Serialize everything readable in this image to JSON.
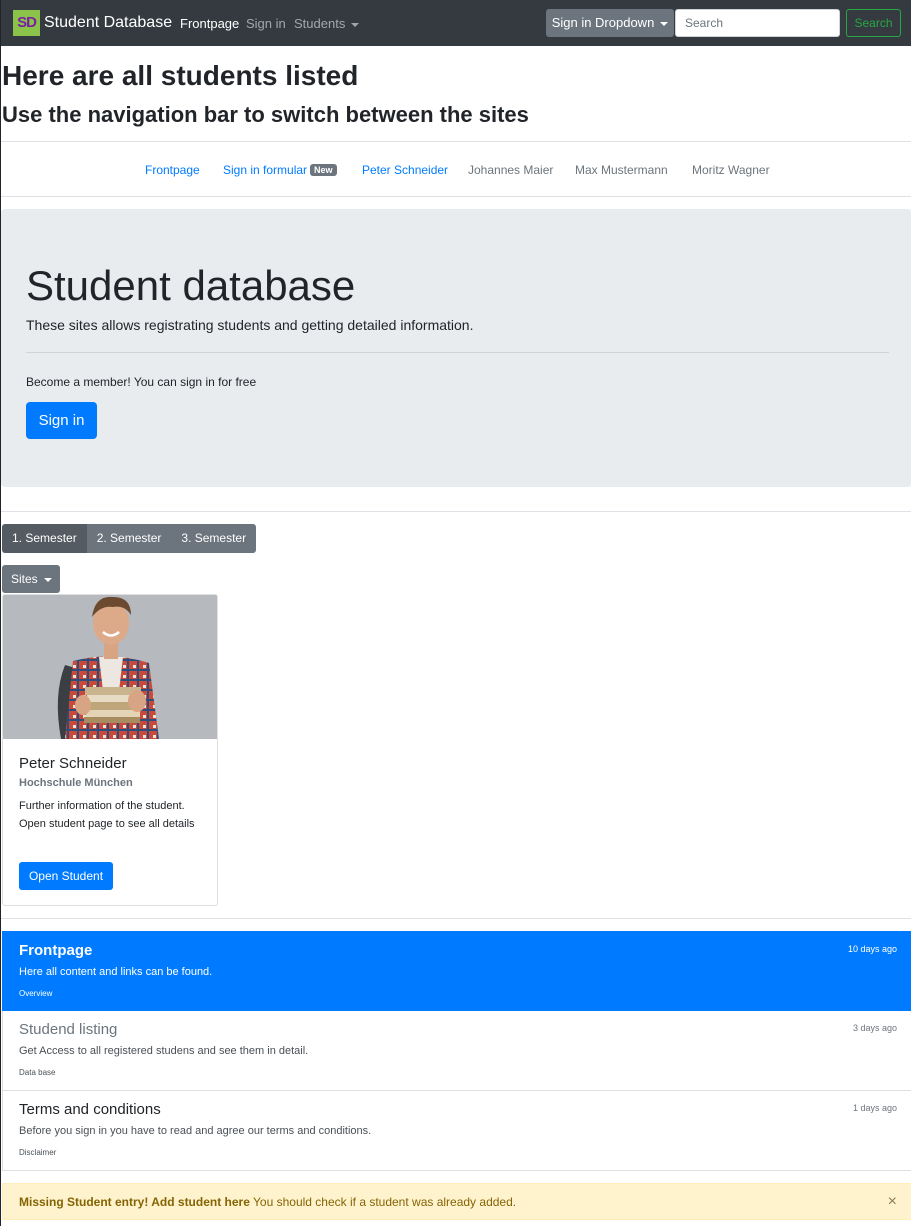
{
  "navbar": {
    "logo": "SD",
    "brand": "Student Database",
    "links": [
      "Frontpage",
      "Sign in",
      "Students"
    ],
    "signin_dropdown": "Sign in Dropdown",
    "search_placeholder": "Search",
    "search_button": "Search"
  },
  "header": {
    "title": "Here are all students listed",
    "subtitle": "Use the navigation bar to switch between the sites"
  },
  "subnav": {
    "items": [
      "Frontpage",
      "Sign in formular",
      "Peter Schneider",
      "Johannes Maier",
      "Max Mustermann",
      "Moritz Wagner"
    ],
    "badge": "New"
  },
  "jumbotron": {
    "title": "Student database",
    "lead": "These sites allows registrating students and getting detailed information.",
    "text": "Become a member! You can sign in for free",
    "button": "Sign in"
  },
  "semesters": [
    "1. Semester",
    "2. Semester",
    "3. Semester"
  ],
  "sites_dropdown": "Sites",
  "card": {
    "title": "Peter Schneider",
    "subtitle": "Hochschule München",
    "text": "Further information of the student. Open student page to see all details",
    "button": "Open Student"
  },
  "list": [
    {
      "title": "Frontpage",
      "time": "10 days ago",
      "desc": "Here all content and links can be found.",
      "small": "Overview"
    },
    {
      "title": "Studend listing",
      "time": "3 days ago",
      "desc": "Get Access to all registered studens and see them in detail.",
      "small": "Data base"
    },
    {
      "title": "Terms and conditions",
      "time": "1 days ago",
      "desc": "Before you sign in you have to read and agree our terms and conditions.",
      "small": "Disclaimer"
    }
  ],
  "alert": {
    "strong": "Missing Student entry! Add student here",
    "text": " You should check if a student was already added.",
    "close": "×"
  },
  "colors": {
    "primary": "#007bff",
    "secondary": "#6c757d",
    "success": "#28a745",
    "dark": "#343a40",
    "warning_bg": "#fff3cd"
  }
}
